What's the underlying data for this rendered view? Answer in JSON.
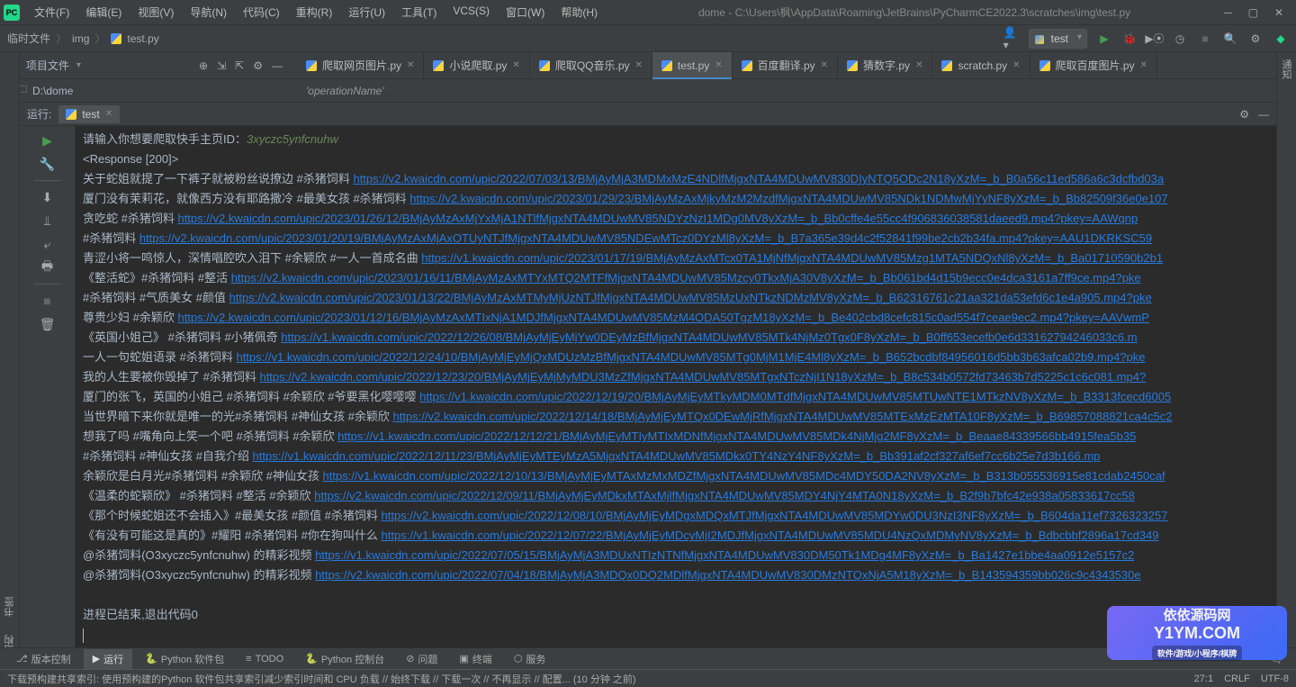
{
  "title": "dome - C:\\Users\\枫\\AppData\\Roaming\\JetBrains\\PyCharmCE2022.3\\scratches\\img\\test.py",
  "menus": {
    "file": "文件(F)",
    "edit": "编辑(E)",
    "view": "视图(V)",
    "nav": "导航(N)",
    "code": "代码(C)",
    "refactor": "重构(R)",
    "run": "运行(U)",
    "tools": "工具(T)",
    "vcs": "VCS(S)",
    "window": "窗口(W)",
    "help": "帮助(H)"
  },
  "breadcrumb": {
    "a": "临时文件",
    "b": "img",
    "c": "test.py"
  },
  "run_config": "test",
  "project_label": "项目文件",
  "path_root": "D:\\dome",
  "op_name": "'operationName'",
  "tabs": [
    {
      "label": "爬取网页图片.py",
      "active": false
    },
    {
      "label": "小说爬取.py",
      "active": false
    },
    {
      "label": "爬取QQ音乐.py",
      "active": false
    },
    {
      "label": "test.py",
      "active": true
    },
    {
      "label": "百度翻译.py",
      "active": false
    },
    {
      "label": "猜数字.py",
      "active": false
    },
    {
      "label": "scratch.py",
      "active": false
    },
    {
      "label": "爬取百度图片.py",
      "active": false
    }
  ],
  "run_panel": {
    "title": "运行:",
    "tab": "test"
  },
  "left_strip": {
    "bookmark": "书签",
    "structure": "结构"
  },
  "prompt": {
    "prefix": "请输入你想要爬取快手主页ID：",
    "input": "3xyczc5ynfcnuhw"
  },
  "response": "<Response [200]>",
  "lines": [
    {
      "text": "关于蛇姐就提了一下裤子就被粉丝说撩边 #杀猪饲料 ",
      "url": "https://v2.kwaicdn.com/upic/2022/07/03/13/BMjAyMjA3MDMxMzE4NDlfMjgxNTA4MDUwMV830DIyNTQ5ODc2N18yXzM=_b_B0a56c11ed586a6c3dcfbd03a"
    },
    {
      "text": "厦门没有茉莉花，就像西方没有耶路撒冷 #最美女孩 #杀猪饲料 ",
      "url": "https://v2.kwaicdn.com/upic/2023/01/29/23/BMjAyMzAxMjkyMzM2MzdfMjgxNTA4MDUwMV85NDk1NDMwMjYyNF8yXzM=_b_Bb82509f36e0e107"
    },
    {
      "text": "贪吃蛇 #杀猪饲料 ",
      "url": "https://v2.kwaicdn.com/upic/2023/01/26/12/BMjAyMzAxMjYxMjA1NTlfMjgxNTA4MDUwMV85NDYzNzI1MDg0MV8yXzM=_b_Bb0cffe4e55cc4f906836038581daeed9.mp4?pkey=AAWqnp"
    },
    {
      "text": "#杀猪饲料 ",
      "url": "https://v2.kwaicdn.com/upic/2023/01/20/19/BMjAyMzAxMjAxOTUyNTJfMjgxNTA4MDUwMV85NDEwMTcz0DYzMl8yXzM=_b_B7a365e39d4c2f52841f99be2cb2b34fa.mp4?pkey=AAU1DKRKSC59"
    },
    {
      "text": "青涩小将一鸣惊人，深情唱腔吹入泪下 #余颖欣 #一人一首成名曲 ",
      "url": "https://v1.kwaicdn.com/upic/2023/01/17/19/BMjAyMzAxMTcx0TA1MjNfMjgxNTA4MDUwMV85Mzg1MTA5NDQxNl8yXzM=_b_Ba01710590b2b1"
    },
    {
      "text": "《整活蛇》#杀猪饲料 #整活 ",
      "url": "https://v2.kwaicdn.com/upic/2023/01/16/11/BMjAyMzAxMTYxMTQ2MTFfMjgxNTA4MDUwMV85Mzcy0TkxMjA30V8yXzM=_b_Bb061bd4d15b9ecc0e4dca3161a7ff9ce.mp4?pke"
    },
    {
      "text": "#杀猪饲料 #气质美女 #颜值 ",
      "url": "https://v2.kwaicdn.com/upic/2023/01/13/22/BMjAyMzAxMTMyMjUzNTJfMjgxNTA4MDUwMV85MzUxNTkzNDMzMV8yXzM=_b_B62316761c21aa321da53efd6c1e4a905.mp4?pke"
    },
    {
      "text": "尊贵少妇 #余颖欣 ",
      "url": "https://v2.kwaicdn.com/upic/2023/01/12/16/BMjAyMzAxMTIxNjA1MDJfMjgxNTA4MDUwMV85MzM4ODA50TgzM18yXzM=_b_Be402cbd8cefc815c0ad554f7ceae9ec2.mp4?pkey=AAVwmP"
    },
    {
      "text": "《英国小姐己》 #杀猪饲料 #小猪佩奇 ",
      "url": "https://v1.kwaicdn.com/upic/2022/12/26/08/BMjAyMjEyMjYw0DEyMzBfMjgxNTA4MDUwMV85MTk4NjMz0Tgx0F8yXzM=_b_B0ff653ecefb0e6d33162794246033c6.m"
    },
    {
      "text": "一人一句蛇姐语录 #杀猪饲料 ",
      "url": "https://v1.kwaicdn.com/upic/2022/12/24/10/BMjAyMjEyMjQxMDUzMzBfMjgxNTA4MDUwMV85MTg0MjM1MjE4Ml8yXzM=_b_B652bcdbf84956016d5bb3b63afca02b9.mp4?pke"
    },
    {
      "text": "我的人生要被你毁掉了 #杀猪饲料 ",
      "url": "https://v2.kwaicdn.com/upic/2022/12/23/20/BMjAyMjEyMjMyMDU3MzZfMjgxNTA4MDUwMV85MTgxNTczNjI1N18yXzM=_b_B8c534b0572fd73463b7d5225c1c6c081.mp4?"
    },
    {
      "text": "厦门的张飞，英国的小姐己 #杀猪饲料 #余颖欣 #爷要黑化嘤嘤嘤 ",
      "url": "https://v1.kwaicdn.com/upic/2022/12/19/20/BMjAyMjEyMTkyMDM0MTdfMjgxNTA4MDUwMV85MTUwNTE1MTkzNV8yXzM=_b_B3313fcecd6005"
    },
    {
      "text": "当世界暗下来你就是唯一的光#杀猪饲料 #神仙女孩 #余颖欣 ",
      "url": "https://v2.kwaicdn.com/upic/2022/12/14/18/BMjAyMjEyMTQx0DEwMjRfMjgxNTA4MDUwMV85MTExMzEzMTA10F8yXzM=_b_B69857088821ca4c5c2"
    },
    {
      "text": "想我了吗 #嘴角向上笑一个吧 #杀猪饲料 #余颖欣 ",
      "url": "https://v1.kwaicdn.com/upic/2022/12/12/21/BMjAyMjEyMTIyMTIxMDNfMjgxNTA4MDUwMV85MDk4NjMjg2MF8yXzM=_b_Beaae84339566bb4915fea5b35"
    },
    {
      "text": "#杀猪饲料 #神仙女孩 #自我介绍 ",
      "url": "https://v1.kwaicdn.com/upic/2022/12/11/23/BMjAyMjEyMTEyMzA5MjgxNTA4MDUwMV85MDkx0TY4NzY4NF8yXzM=_b_Bb391af2cf327af6ef7cc6b25e7d3b166.mp"
    },
    {
      "text": "余颖欣是白月光#杀猪饲料 #余颖欣 #神仙女孩 ",
      "url": "https://v1.kwaicdn.com/upic/2022/12/10/13/BMjAyMjEyMTAxMzMxMDZfMjgxNTA4MDUwMV85MDc4MDY50DA2NV8yXzM=_b_B313b055536915e81cdab2450caf"
    },
    {
      "text": "《温柔的蛇颖欣》 #杀猪饲料 #整活 #余颖欣 ",
      "url": "https://v2.kwaicdn.com/upic/2022/12/09/11/BMjAyMjEyMDkxMTAxMjlfMjgxNTA4MDUwMV85MDY4NjY4MTA0N18yXzM=_b_B2f9b7bfc42e938a05833617cc58"
    },
    {
      "text": "《那个时候蛇姐还不会插入》#最美女孩 #颜值 #杀猪饲料 ",
      "url": "https://v2.kwaicdn.com/upic/2022/12/08/10/BMjAyMjEyMDgxMDQxMTJfMjgxNTA4MDUwMV85MDYw0DU3NzI3NF8yXzM=_b_B604da11ef7326323257"
    },
    {
      "text": "《有没有可能这是真的》#耀阳 #杀猪饲料 #你在狗叫什么 ",
      "url": "https://v1.kwaicdn.com/upic/2022/12/07/22/BMjAyMjEyMDcyMjI2MDJfMjgxNTA4MDUwMV85MDU4NzQxMDMyNV8yXzM=_b_Bdbcbbf2896a17cd349"
    },
    {
      "text": "@杀猪饲料(O3xyczc5ynfcnuhw) 的精彩视频 ",
      "url": "https://v1.kwaicdn.com/upic/2022/07/05/15/BMjAyMjA3MDUxNTIzNTNfMjgxNTA4MDUwMV830DM50Tk1MDg4MF8yXzM=_b_Ba1427e1bbe4aa0912e5157c2"
    },
    {
      "text": "@杀猪饲料(O3xyczc5ynfcnuhw) 的精彩视频 ",
      "url": "https://v2.kwaicdn.com/upic/2022/07/04/18/BMjAyMjA3MDQx0DQ2MDlfMjgxNTA4MDUwMV830DMzNTQxNjA5M18yXzM=_b_B143594359bb026c9c4343530e"
    }
  ],
  "exit_msg": "进程已结束,退出代码0",
  "bottom": {
    "vcs": "版本控制",
    "run": "运行",
    "pkg": "Python 软件包",
    "todo": "TODO",
    "console": "Python 控制台",
    "problems": "问题",
    "terminal": "终端",
    "services": "服务"
  },
  "status": {
    "left": "下载预构建共享索引: 使用预构建的Python 软件包共享索引减少索引时间和 CPU 负载 // 始终下载 // 下载一次 // 不再显示 // 配置... (10 分钟 之前)",
    "pos": "27:1",
    "eol": "CRLF",
    "enc": "UTF-8"
  },
  "watermark": {
    "main": "依依源码网",
    "url": "Y1YM.COM",
    "sub": "软件/游戏/小程序/棋牌"
  }
}
